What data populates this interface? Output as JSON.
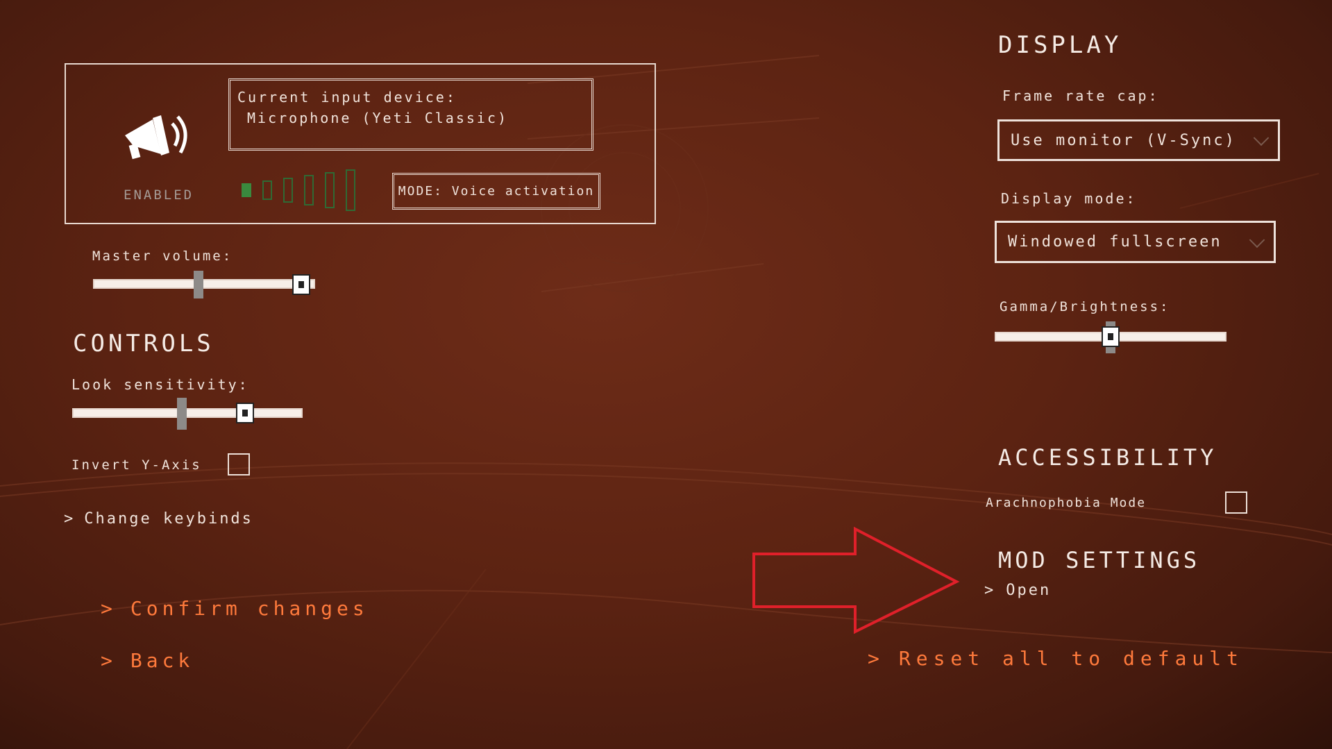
{
  "voice": {
    "device_label": "Current input device:",
    "device_value": "Microphone (Yeti Classic)",
    "status": "ENABLED",
    "mode_button": "MODE: Voice activation",
    "meter_level": 1,
    "meter_segments": 6
  },
  "audio": {
    "master_volume_label": "Master volume:",
    "master_volume_level": 0.95
  },
  "controls": {
    "heading": "CONTROLS",
    "look_label": "Look sensitivity:",
    "look_level": 0.75,
    "invert_label": "Invert Y-Axis",
    "invert_checked": false,
    "keybinds_link": "Change keybinds"
  },
  "actions": {
    "confirm": "Confirm changes",
    "back": "Back",
    "reset": "Reset all to default"
  },
  "display": {
    "heading": "DISPLAY",
    "frame_rate_label": "Frame rate cap:",
    "frame_rate_value": "Use monitor (V-Sync)",
    "mode_label": "Display mode:",
    "mode_value": "Windowed fullscreen",
    "gamma_label": "Gamma/Brightness:",
    "gamma_level": 0.5
  },
  "accessibility": {
    "heading": "ACCESSIBILITY",
    "arachnophobia_label": "Arachnophobia Mode",
    "arachnophobia_checked": false
  },
  "mod_settings": {
    "heading": "MOD SETTINGS",
    "open_link": "Open"
  },
  "icons": {
    "chevron": "chevron-right-icon",
    "speaker": "megaphone-icon"
  },
  "colors": {
    "accent_orange": "#ff7a3c",
    "annotation_red": "#e0202a",
    "meter_green": "#3a8a3e"
  }
}
